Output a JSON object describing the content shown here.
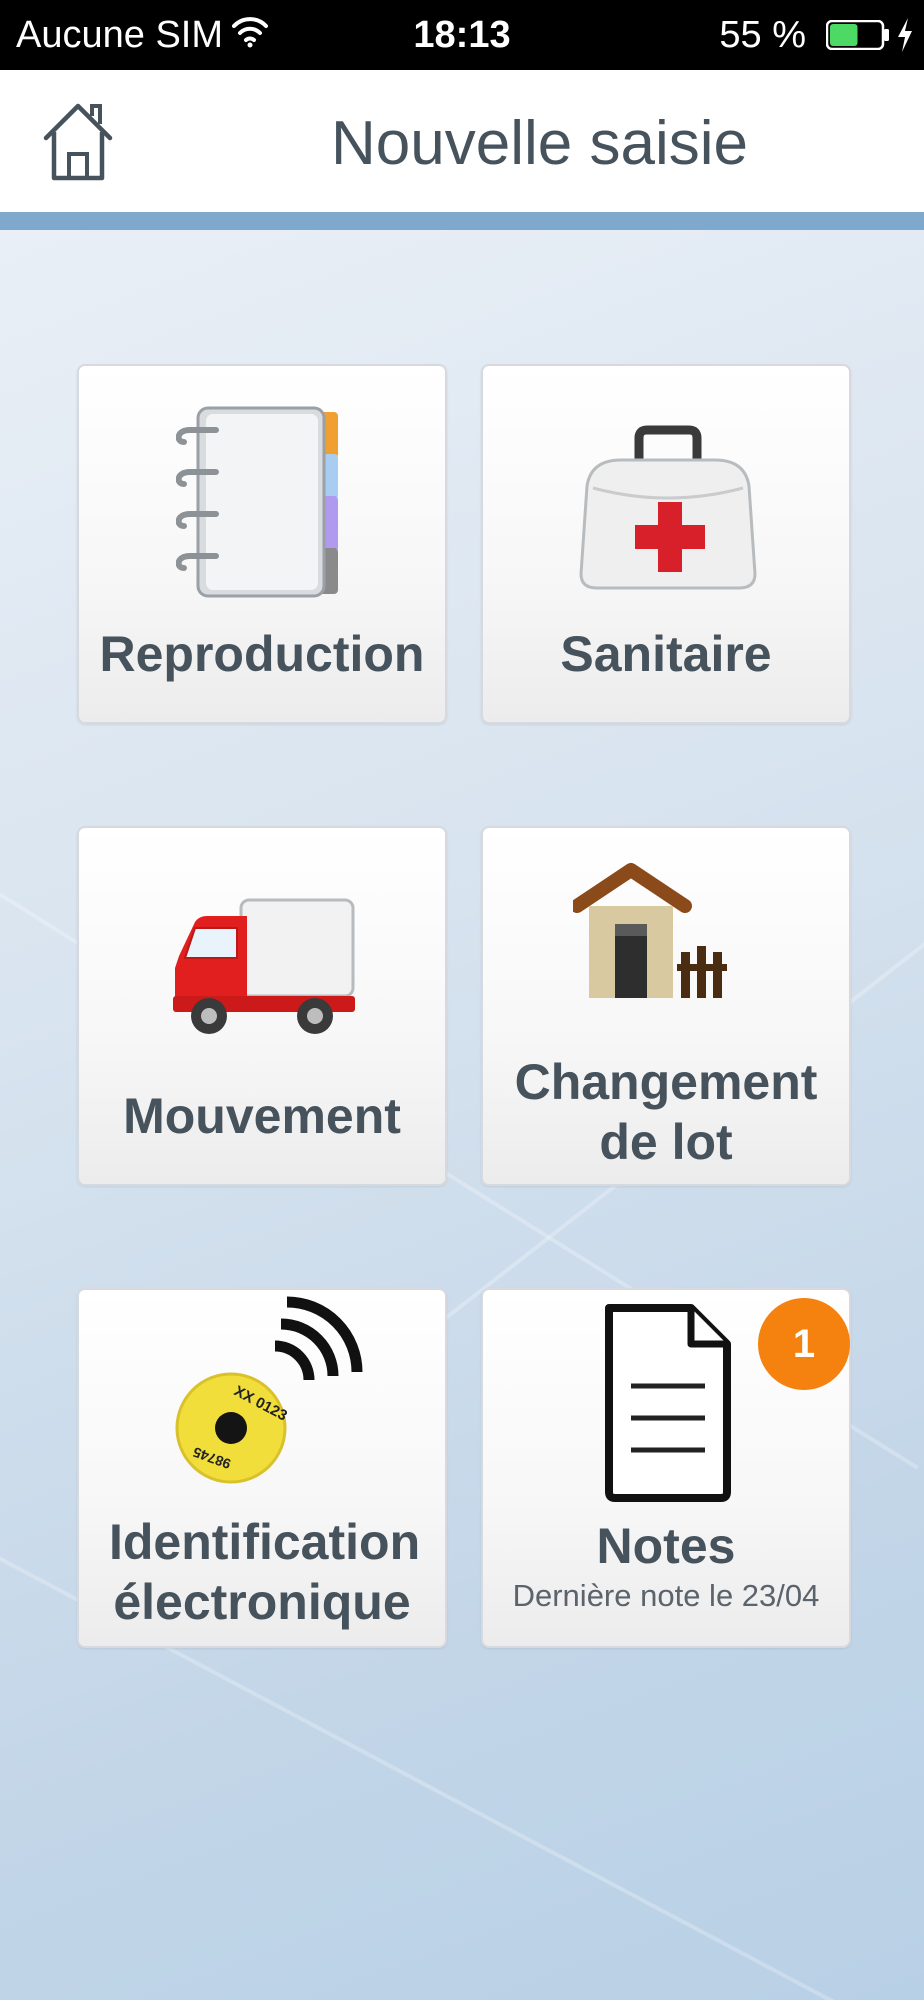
{
  "status_bar": {
    "carrier": "Aucune SIM",
    "time": "18:13",
    "battery_percent": "55 %",
    "battery_level": 0.55,
    "battery_color": "#4cd964"
  },
  "header": {
    "title": "Nouvelle saisie",
    "home_icon": "home-icon"
  },
  "tiles": [
    {
      "label": "Reproduction",
      "icon": "notebook-icon"
    },
    {
      "label": "Sanitaire",
      "icon": "medical-bag-icon"
    },
    {
      "label": "Mouvement",
      "icon": "truck-icon"
    },
    {
      "label": "Changement de lot",
      "icon": "barn-icon"
    },
    {
      "label": "Identification électronique",
      "icon": "rfid-tag-icon",
      "tag_text": [
        "XX 0123",
        "98745"
      ]
    },
    {
      "label": "Notes",
      "icon": "document-icon",
      "sublabel": "Dernière note le 23/04",
      "badge": "1"
    }
  ],
  "colors": {
    "accent_rule": "#7fa9cc",
    "text": "#46525c",
    "badge": "#f5820f"
  }
}
